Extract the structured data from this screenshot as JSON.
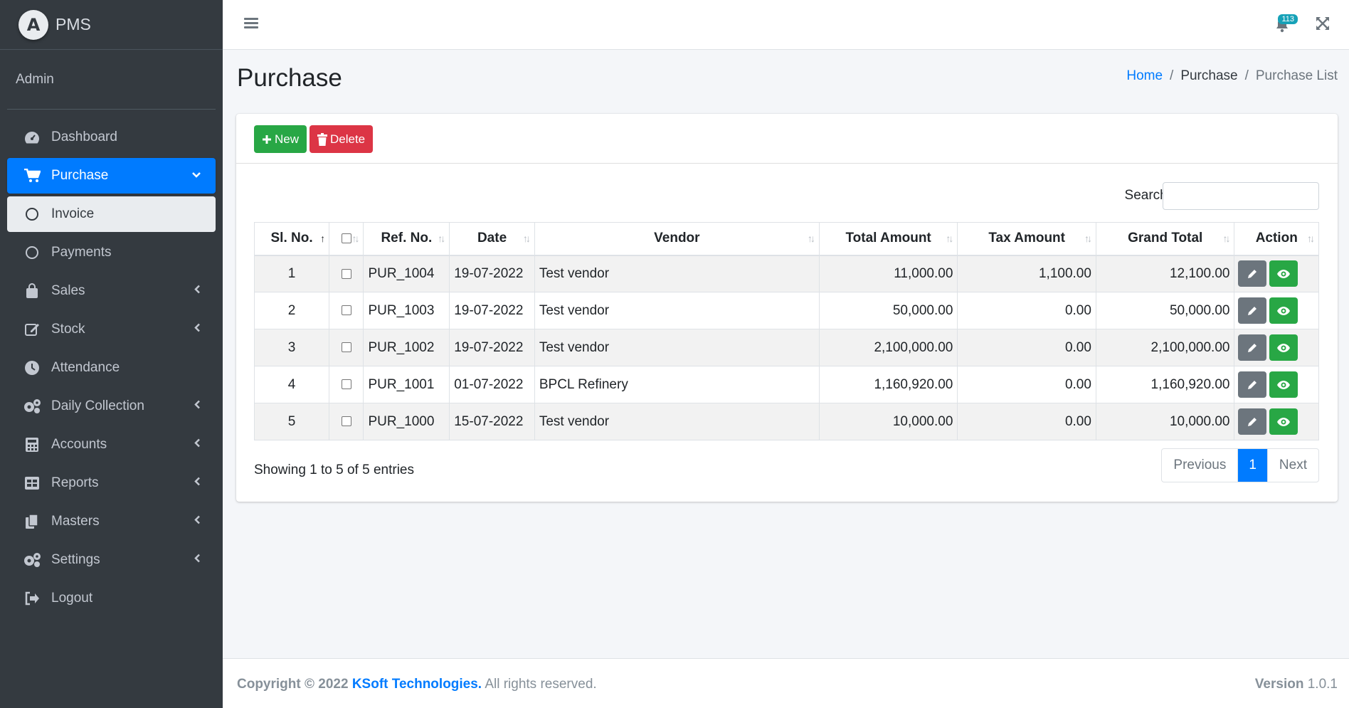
{
  "sidebar": {
    "brand_logo": "A",
    "brand": "PMS",
    "user": "Admin",
    "items": [
      {
        "label": "Dashboard",
        "icon": "dashboard-icon"
      },
      {
        "label": "Purchase",
        "icon": "cart-icon"
      },
      {
        "label": "Invoice",
        "icon": "circle-icon"
      },
      {
        "label": "Payments",
        "icon": "circle-icon"
      },
      {
        "label": "Sales",
        "icon": "bag-icon"
      },
      {
        "label": "Stock",
        "icon": "edit-icon"
      },
      {
        "label": "Attendance",
        "icon": "clock-icon"
      },
      {
        "label": "Daily Collection",
        "icon": "cogs-icon"
      },
      {
        "label": "Accounts",
        "icon": "calculator-icon"
      },
      {
        "label": "Reports",
        "icon": "table-icon"
      },
      {
        "label": "Masters",
        "icon": "copy-icon"
      },
      {
        "label": "Settings",
        "icon": "cogs-icon"
      },
      {
        "label": "Logout",
        "icon": "logout-icon"
      }
    ]
  },
  "topbar": {
    "notification_count": "113"
  },
  "header": {
    "title": "Purchase",
    "breadcrumb": [
      "Home",
      "Purchase",
      "Purchase List"
    ]
  },
  "toolbar": {
    "new_label": "New",
    "delete_label": "Delete"
  },
  "search": {
    "label": "Search:",
    "value": ""
  },
  "table": {
    "columns": [
      "Sl. No.",
      "",
      "Ref. No.",
      "Date",
      "Vendor",
      "Total Amount",
      "Tax Amount",
      "Grand Total",
      "Action"
    ],
    "rows": [
      [
        "1",
        "PUR_1004",
        "19-07-2022",
        "Test vendor",
        "11,000.00",
        "1,100.00",
        "12,100.00"
      ],
      [
        "2",
        "PUR_1003",
        "19-07-2022",
        "Test vendor",
        "50,000.00",
        "0.00",
        "50,000.00"
      ],
      [
        "3",
        "PUR_1002",
        "19-07-2022",
        "Test vendor",
        "2,100,000.00",
        "0.00",
        "2,100,000.00"
      ],
      [
        "4",
        "PUR_1001",
        "01-07-2022",
        "BPCL Refinery",
        "1,160,920.00",
        "0.00",
        "1,160,920.00"
      ],
      [
        "5",
        "PUR_1000",
        "15-07-2022",
        "Test vendor",
        "10,000.00",
        "0.00",
        "10,000.00"
      ]
    ]
  },
  "info": "Showing 1 to 5 of 5 entries",
  "pagination": {
    "previous": "Previous",
    "current": "1",
    "next": "Next"
  },
  "footer": {
    "copyright": "Copyright © 2022",
    "company": "KSoft Technologies.",
    "rights": "All rights reserved.",
    "version_label": "Version",
    "version": "1.0.1"
  },
  "colors": {
    "primary": "#007bff",
    "success": "#28a745",
    "danger": "#dc3545",
    "sidebar": "#343a40"
  }
}
